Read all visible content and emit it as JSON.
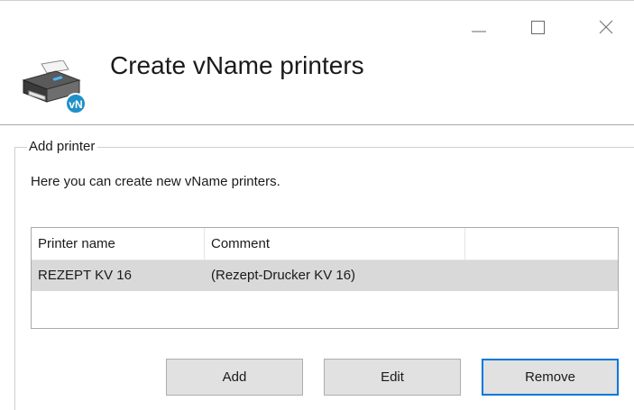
{
  "window": {
    "title": "Create vName printers"
  },
  "icons": {
    "header": "printer-vname-icon",
    "badge_text": "vN",
    "minimize": "minimize-icon",
    "maximize": "maximize-icon",
    "close": "close-icon"
  },
  "group": {
    "legend": "Add printer",
    "description": "Here you can create new vName printers."
  },
  "list": {
    "columns": [
      "Printer name",
      "Comment",
      ""
    ],
    "rows": [
      {
        "name": "REZEPT KV 16",
        "comment": "(Rezept-Drucker KV 16)",
        "selected": true
      }
    ]
  },
  "buttons": {
    "add": "Add",
    "edit": "Edit",
    "remove": "Remove"
  },
  "colors": {
    "selected_row": "#d9d9d9",
    "focus_border": "#0078d7",
    "badge": "#1e90c8"
  }
}
